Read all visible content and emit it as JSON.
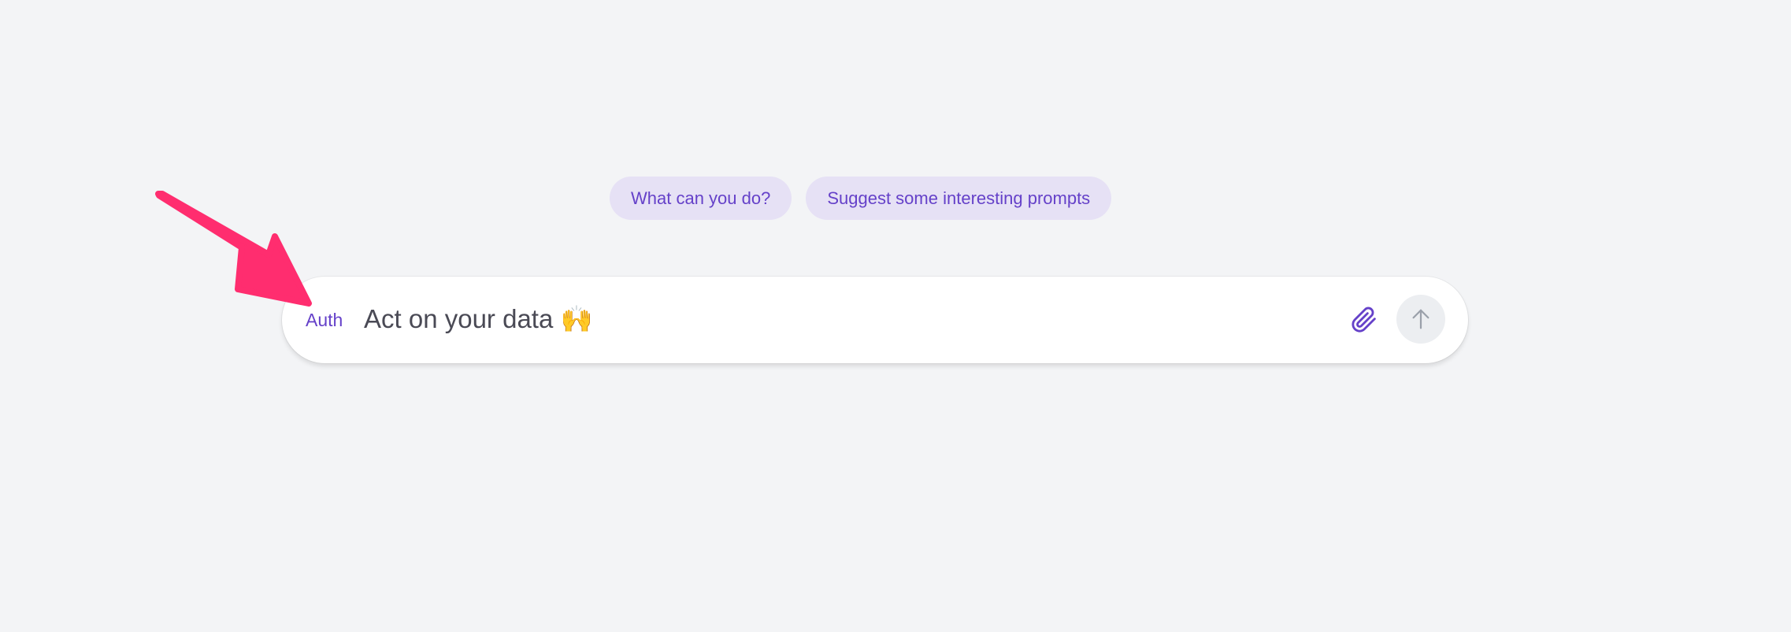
{
  "suggestions": [
    {
      "label": "What can you do?"
    },
    {
      "label": "Suggest some interesting prompts"
    }
  ],
  "composer": {
    "auth_label": "Auth",
    "placeholder": "Act on your data 🙌",
    "attach_icon": "paperclip-icon",
    "send_icon": "arrow-up-icon"
  },
  "annotation": {
    "icon": "pointer-arrow-icon",
    "color": "#ff2d6f"
  },
  "colors": {
    "background": "#f3f4f6",
    "accent": "#6541c9",
    "chip_background": "#e6e1f5",
    "send_button_background": "#eceef1"
  }
}
